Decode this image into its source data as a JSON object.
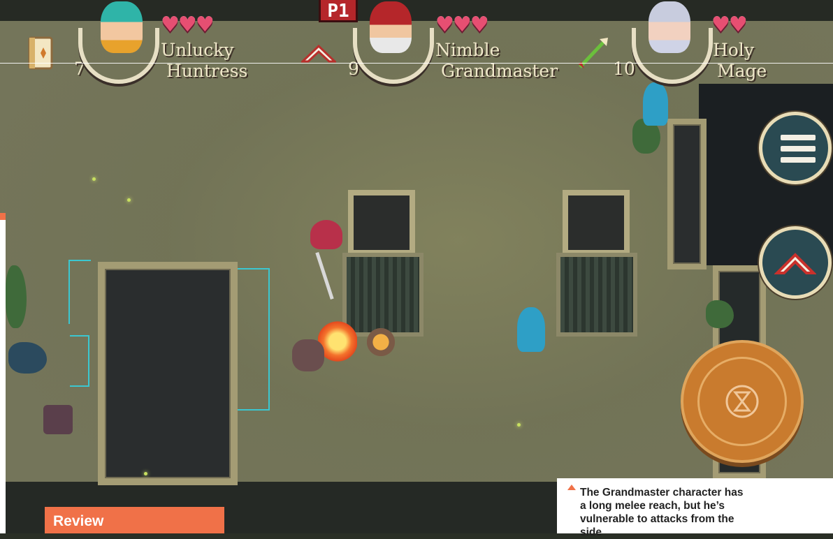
{
  "hud": {
    "player_tag": "P1",
    "characters": [
      {
        "first": "Unlucky",
        "second": "Huntress",
        "count": "7",
        "hearts": 3,
        "item": "book-icon"
      },
      {
        "first": "Nimble",
        "second": "Grandmaster",
        "count": "9",
        "hearts": 3,
        "item": "boomerang-icon"
      },
      {
        "first": "Holy",
        "second": "Mage",
        "count": "10",
        "hearts": 2,
        "item": "arrow-icon"
      }
    ]
  },
  "controls": {
    "menu": "hamburger-menu-icon",
    "skill": "boomerang-icon",
    "action": "hourglass-icon"
  },
  "magazine": {
    "section_tag": "Review",
    "caption": "The Grandmaster character has a long melee reach, but he’s vulnerable to attacks from the side"
  },
  "colors": {
    "heart": "#e64f72",
    "accent": "#f07148",
    "action_button": "#c97b2e",
    "menu_button": "#2a4a52"
  }
}
